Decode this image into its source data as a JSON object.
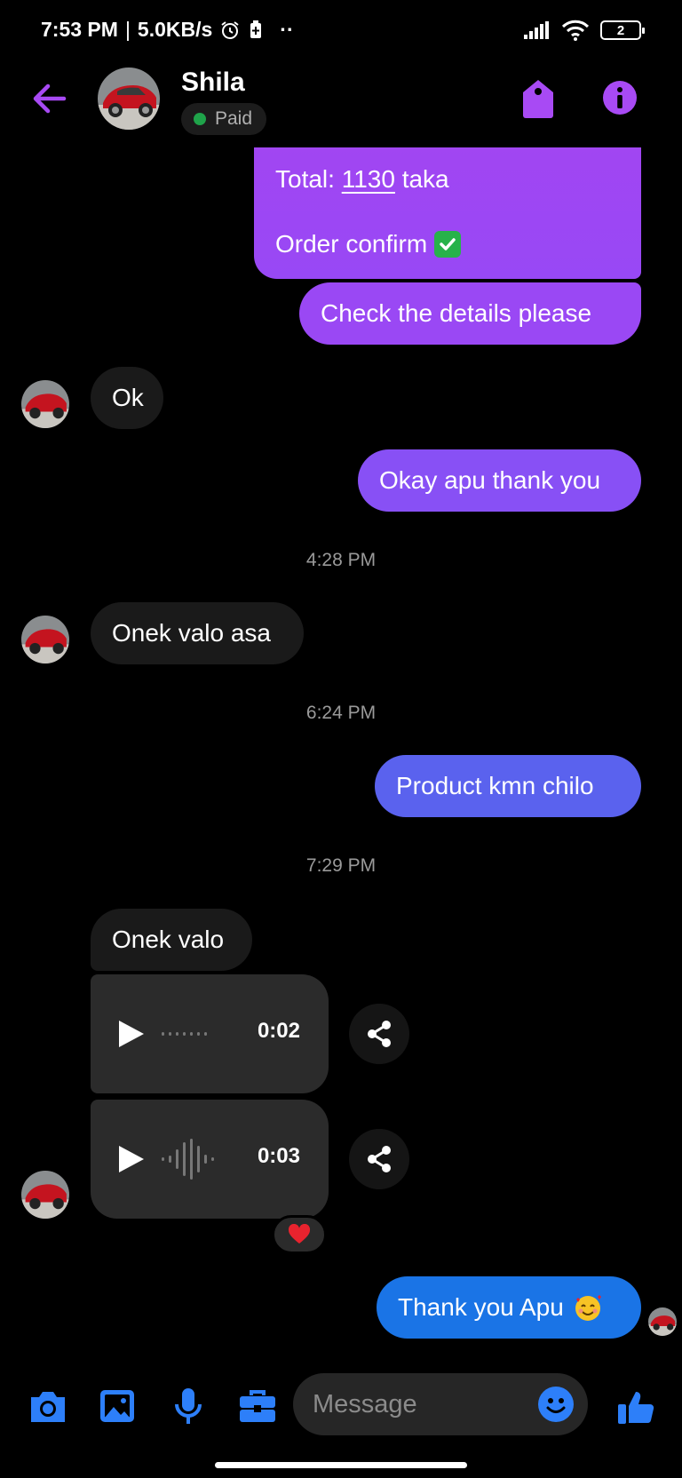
{
  "status_bar": {
    "time": "7:53 PM",
    "separator": "|",
    "speed": "5.0KB/s",
    "more": "··",
    "battery_level": "2"
  },
  "header": {
    "name": "Shila",
    "label": "Paid",
    "label_color": "#1fa34a",
    "accent": "#a84af4"
  },
  "messages": {
    "total_prefix": "Total: ",
    "total_amount": "1130",
    "total_suffix": " taka",
    "order_confirm": "Order confirm",
    "check_details": "Check the details please",
    "ok": "Ok",
    "okay_thanks": "Okay apu thank you",
    "time_1": "4:28 PM",
    "onek_valo_asa": "Onek valo asa",
    "time_2": "6:24 PM",
    "product_kmn": "Product kmn chilo",
    "time_3": "7:29 PM",
    "onek_valo": "Onek valo",
    "voice_1_duration": "0:02",
    "voice_2_duration": "0:03",
    "thank_you_apu": "Thank you Apu"
  },
  "composer": {
    "placeholder": "Message"
  },
  "icons": [
    "back-arrow-icon",
    "tag-icon",
    "info-icon",
    "play-icon",
    "share-icon",
    "heart-icon",
    "camera-icon",
    "image-icon",
    "microphone-icon",
    "briefcase-icon",
    "emoji-icon",
    "thumbs-up-icon"
  ]
}
